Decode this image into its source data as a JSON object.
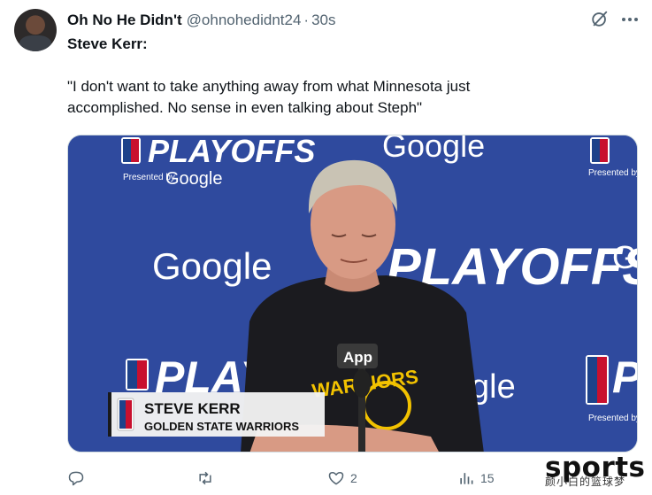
{
  "author": {
    "display_name": "Oh No He Didn't",
    "handle": "@ohnohedidnt24",
    "separator": "·",
    "time": "30s"
  },
  "tweet": {
    "speaker": "Steve Kerr:",
    "quote_line_1": "\"I don't want to take anything away from what Minnesota just",
    "quote_line_2": "accomplished. No sense in even talking about Steph\""
  },
  "media": {
    "backdrop_word_playoffs": "PLAYOFFS",
    "backdrop_word_google": "Google",
    "backdrop_presented_by": "Presented by",
    "backdrop_nba": "NBA",
    "mic_label": "App",
    "lower_third_name": "STEVE KERR",
    "lower_third_team": "GOLDEN STATE WARRIORS",
    "shirt_text": "WARRIORS",
    "colors": {
      "backdrop": "#2f4a9e",
      "shirt": "#1b1b1f",
      "shirt_print": "#f2c200",
      "hair": "#c9c3b4",
      "skin": "#d89a84"
    }
  },
  "actions": {
    "reply_count": "",
    "repost_count": "",
    "like_count": "2",
    "views_count": "15"
  },
  "watermark": {
    "word": "sports",
    "sub": "颜小白的篮球梦"
  },
  "icons": [
    "grok-icon",
    "more-icon",
    "reply-icon",
    "repost-icon",
    "like-icon",
    "views-icon"
  ]
}
